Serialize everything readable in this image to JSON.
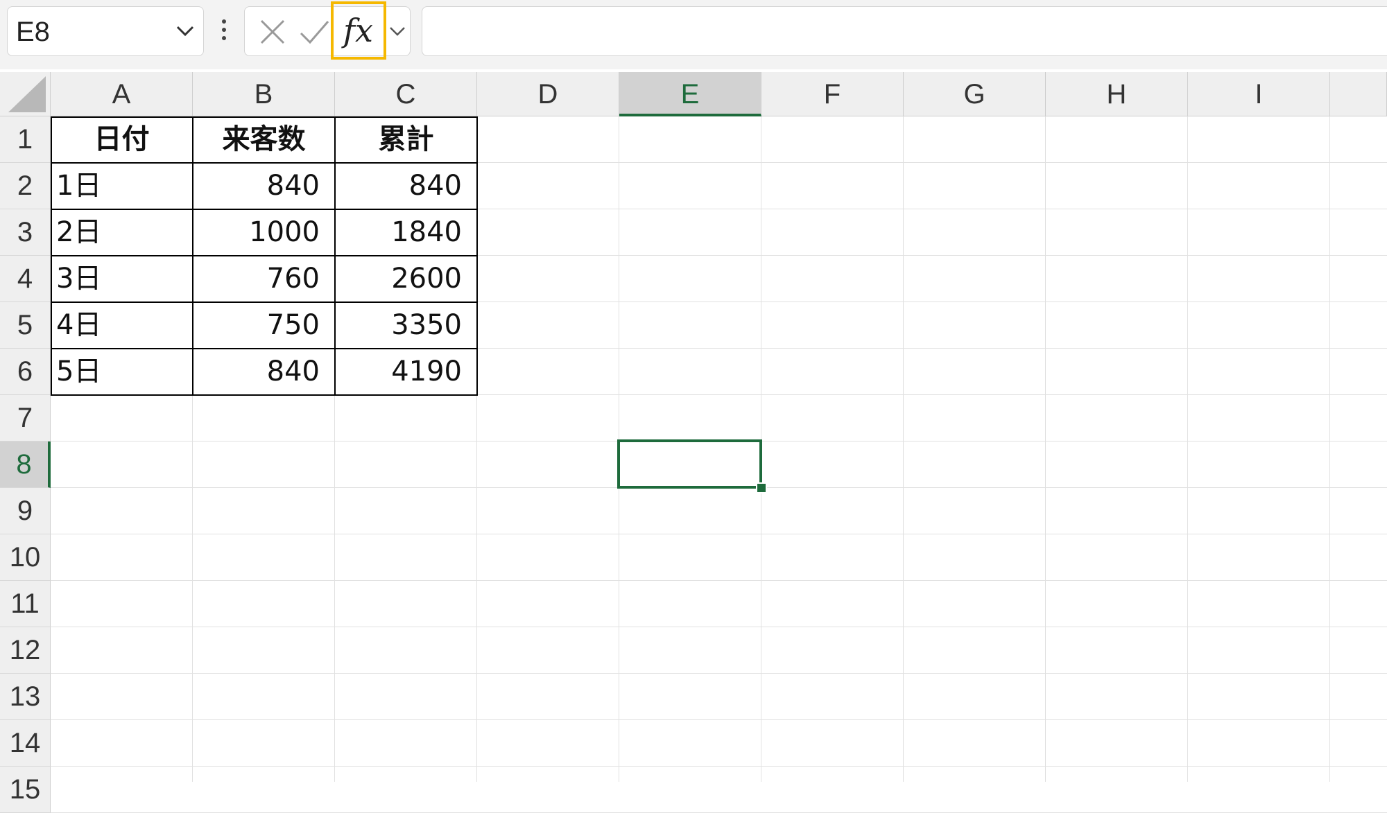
{
  "formula_bar": {
    "name_box": "E8",
    "cancel_icon": "close-icon",
    "enter_icon": "check-icon",
    "fx_label": "fx",
    "formula": "",
    "highlight_color": "#f5b800"
  },
  "grid": {
    "columns": [
      "A",
      "B",
      "C",
      "D",
      "E",
      "F",
      "G",
      "H",
      "I"
    ],
    "rows": [
      "1",
      "2",
      "3",
      "4",
      "5",
      "6",
      "7",
      "8",
      "9",
      "10",
      "11",
      "12",
      "13",
      "14",
      "15"
    ],
    "selected_column": "E",
    "selected_row": "8",
    "accent_color": "#1e6b3c"
  },
  "table": {
    "headers": [
      "日付",
      "来客数",
      "累計"
    ],
    "rows": [
      [
        "1日",
        "840",
        "840"
      ],
      [
        "2日",
        "1000",
        "1840"
      ],
      [
        "3日",
        "760",
        "2600"
      ],
      [
        "4日",
        "750",
        "3350"
      ],
      [
        "5日",
        "840",
        "4190"
      ]
    ]
  }
}
